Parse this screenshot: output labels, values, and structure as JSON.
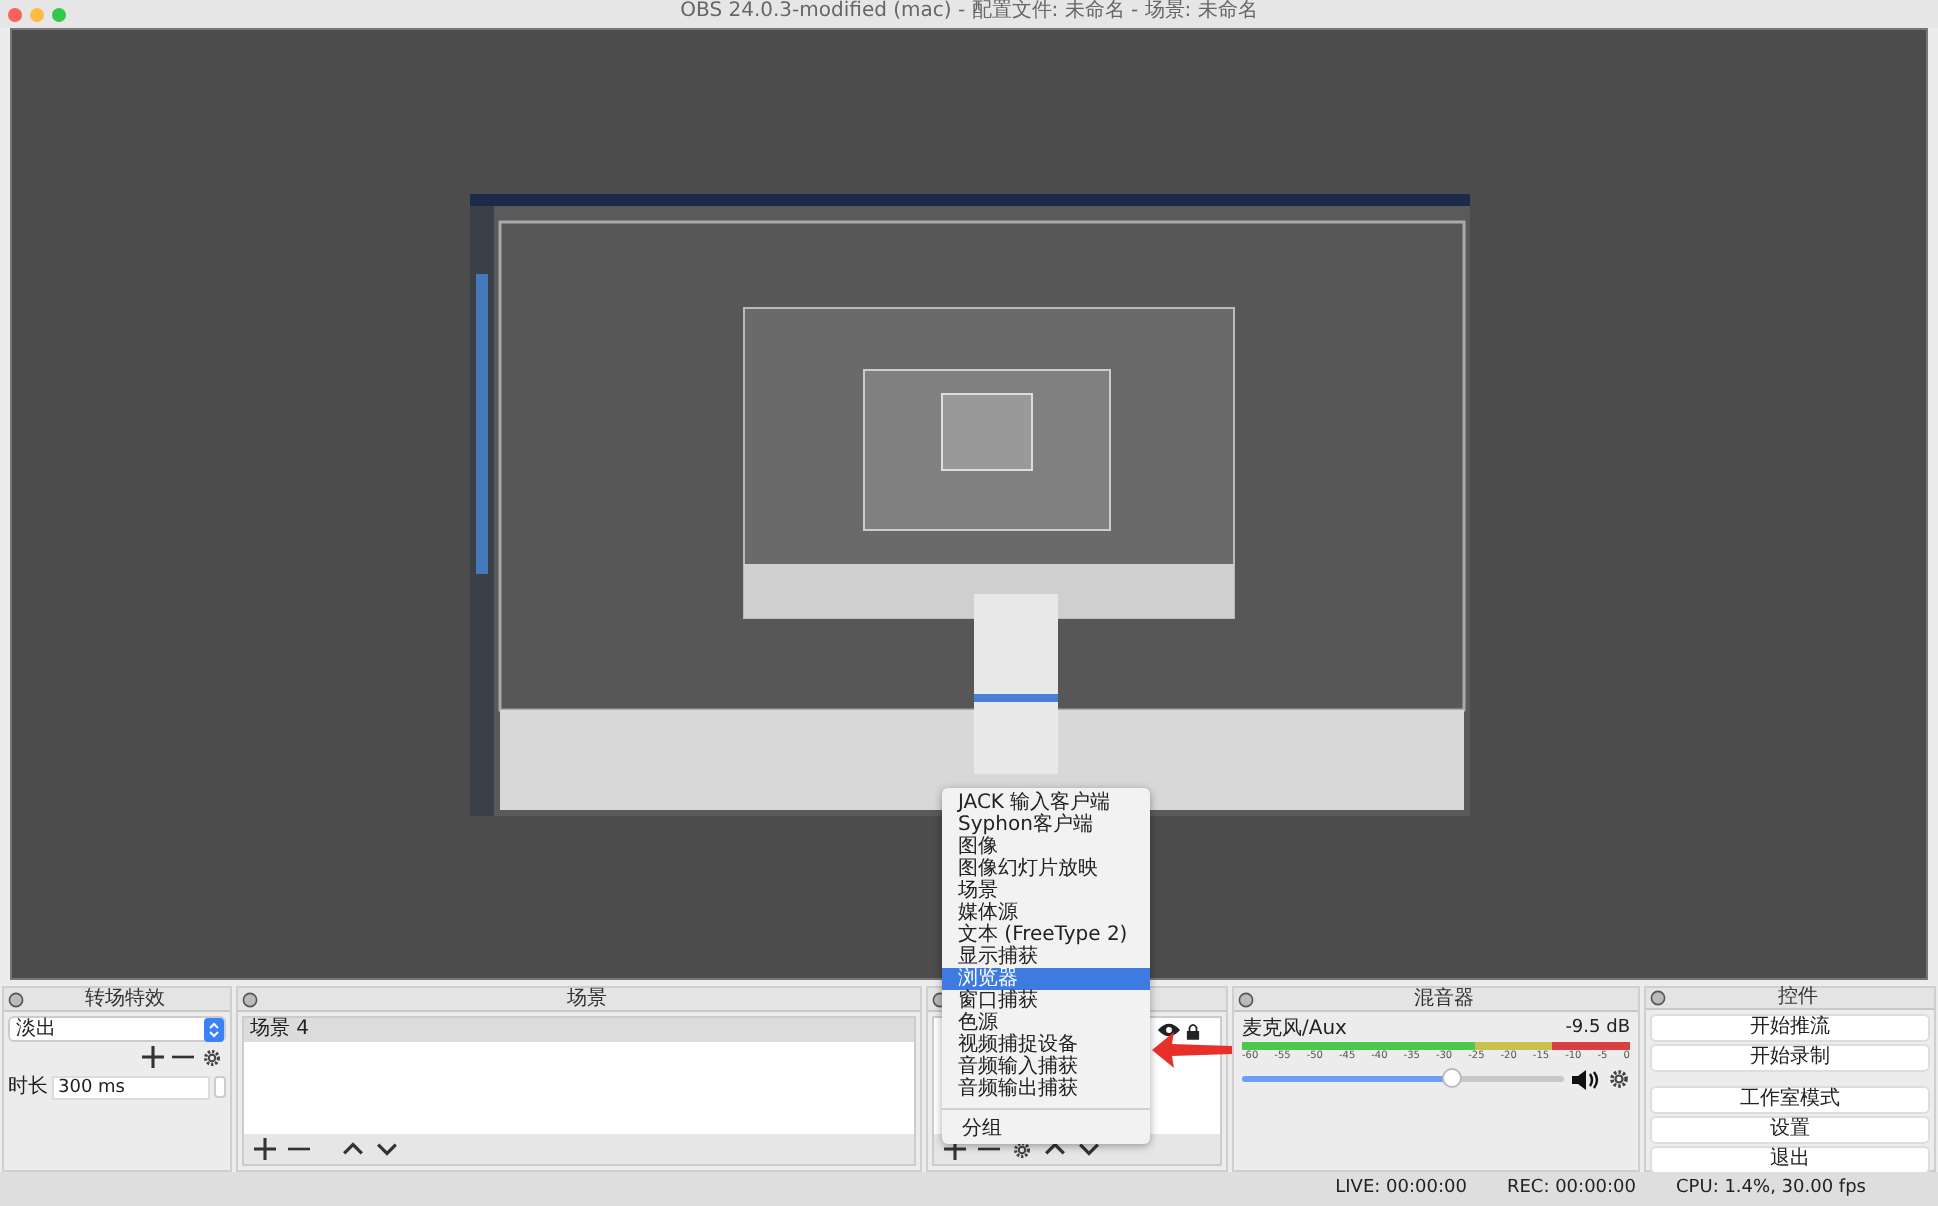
{
  "window": {
    "title": "OBS 24.0.3-modified (mac) - 配置文件: 未命名 - 场景: 未命名"
  },
  "context_menu": {
    "items": [
      {
        "label": "JACK 输入客户端",
        "selected": false
      },
      {
        "label": "Syphon客户端",
        "selected": false
      },
      {
        "label": "图像",
        "selected": false
      },
      {
        "label": "图像幻灯片放映",
        "selected": false
      },
      {
        "label": "场景",
        "selected": false
      },
      {
        "label": "媒体源",
        "selected": false
      },
      {
        "label": "文本 (FreeType 2)",
        "selected": false
      },
      {
        "label": "显示捕获",
        "selected": false
      },
      {
        "label": "浏览器",
        "selected": true
      },
      {
        "label": "窗口捕获",
        "selected": false
      },
      {
        "label": "色源",
        "selected": false
      },
      {
        "label": "视频捕捉设备",
        "selected": false
      },
      {
        "label": "音频输入捕获",
        "selected": false
      },
      {
        "label": "音频输出捕获",
        "selected": false
      }
    ],
    "footer_items": [
      {
        "label": "分组",
        "selected": false
      }
    ]
  },
  "transitions": {
    "title": "转场特效",
    "select_value": "淡出",
    "duration_label": "时长",
    "duration_value": "300 ms"
  },
  "scenes": {
    "title": "场景",
    "items": [
      {
        "label": "场景 4",
        "selected": true
      }
    ]
  },
  "sources": {
    "items": [
      {
        "visible": true,
        "locked": true
      }
    ]
  },
  "mixer": {
    "title": "混音器",
    "channel": {
      "name": "麦克风/Aux",
      "reading": "-9.5 dB",
      "level": 0.65,
      "ticks": [
        "-60",
        "-55",
        "-50",
        "-45",
        "-40",
        "-35",
        "-30",
        "-25",
        "-20",
        "-15",
        "-10",
        "-5",
        "0"
      ]
    }
  },
  "controls": {
    "title": "控件",
    "buttons": [
      "开始推流",
      "开始录制",
      "工作室模式",
      "设置",
      "退出"
    ]
  },
  "status_bar": {
    "live": "LIVE: 00:00:00",
    "rec": "REC: 00:00:00",
    "cpu": "CPU: 1.4%, 30.00 fps"
  }
}
